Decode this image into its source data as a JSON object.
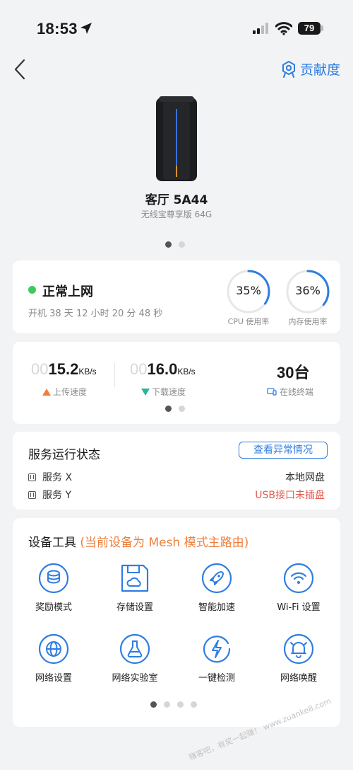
{
  "status_bar": {
    "time": "18:53",
    "battery": "79"
  },
  "header": {
    "contribution_label": "贡献度"
  },
  "device": {
    "name": "客厅 5A44",
    "model": "无线宝尊享版 64G"
  },
  "status": {
    "network_label": "正常上网",
    "uptime": "开机 38 天 12 小时 20 分 48 秒",
    "cpu": {
      "value": "35%",
      "label": "CPU 使用率",
      "percent": 35
    },
    "memory": {
      "value": "36%",
      "label": "内存使用率",
      "percent": 36
    }
  },
  "speed": {
    "upload": {
      "prefix": "00",
      "value": "15.2",
      "unit": "KB/s",
      "label": "上传速度"
    },
    "download": {
      "prefix": "00",
      "value": "16.0",
      "unit": "KB/s",
      "label": "下载速度"
    },
    "devices": {
      "value": "30台",
      "label": "在线终端"
    }
  },
  "services": {
    "title": "服务运行状态",
    "button": "查看异常情况",
    "items": [
      {
        "name": "服务 X",
        "status": "本地网盘"
      },
      {
        "name": "服务 Y",
        "status": "USB接口未插盘"
      }
    ]
  },
  "tools": {
    "title": "设备工具",
    "subtitle": "(当前设备为 Mesh 模式主路由)",
    "items": [
      {
        "label": "奖励模式",
        "icon": "coins-icon"
      },
      {
        "label": "存储设置",
        "icon": "storage-cloud-icon"
      },
      {
        "label": "智能加速",
        "icon": "rocket-icon"
      },
      {
        "label": "Wi-Fi 设置",
        "icon": "wifi-icon"
      },
      {
        "label": "网络设置",
        "icon": "globe-icon"
      },
      {
        "label": "网络实验室",
        "icon": "flask-icon"
      },
      {
        "label": "一键检测",
        "icon": "lightning-icon"
      },
      {
        "label": "网络唤醒",
        "icon": "bell-icon"
      }
    ]
  },
  "colors": {
    "accent": "#2f7de1",
    "online": "#3ec95f",
    "warning": "#e05a4f",
    "highlight": "#f07e3a"
  },
  "watermark": "赚客吧，有奖一起赚！ www.zuanke8.com"
}
